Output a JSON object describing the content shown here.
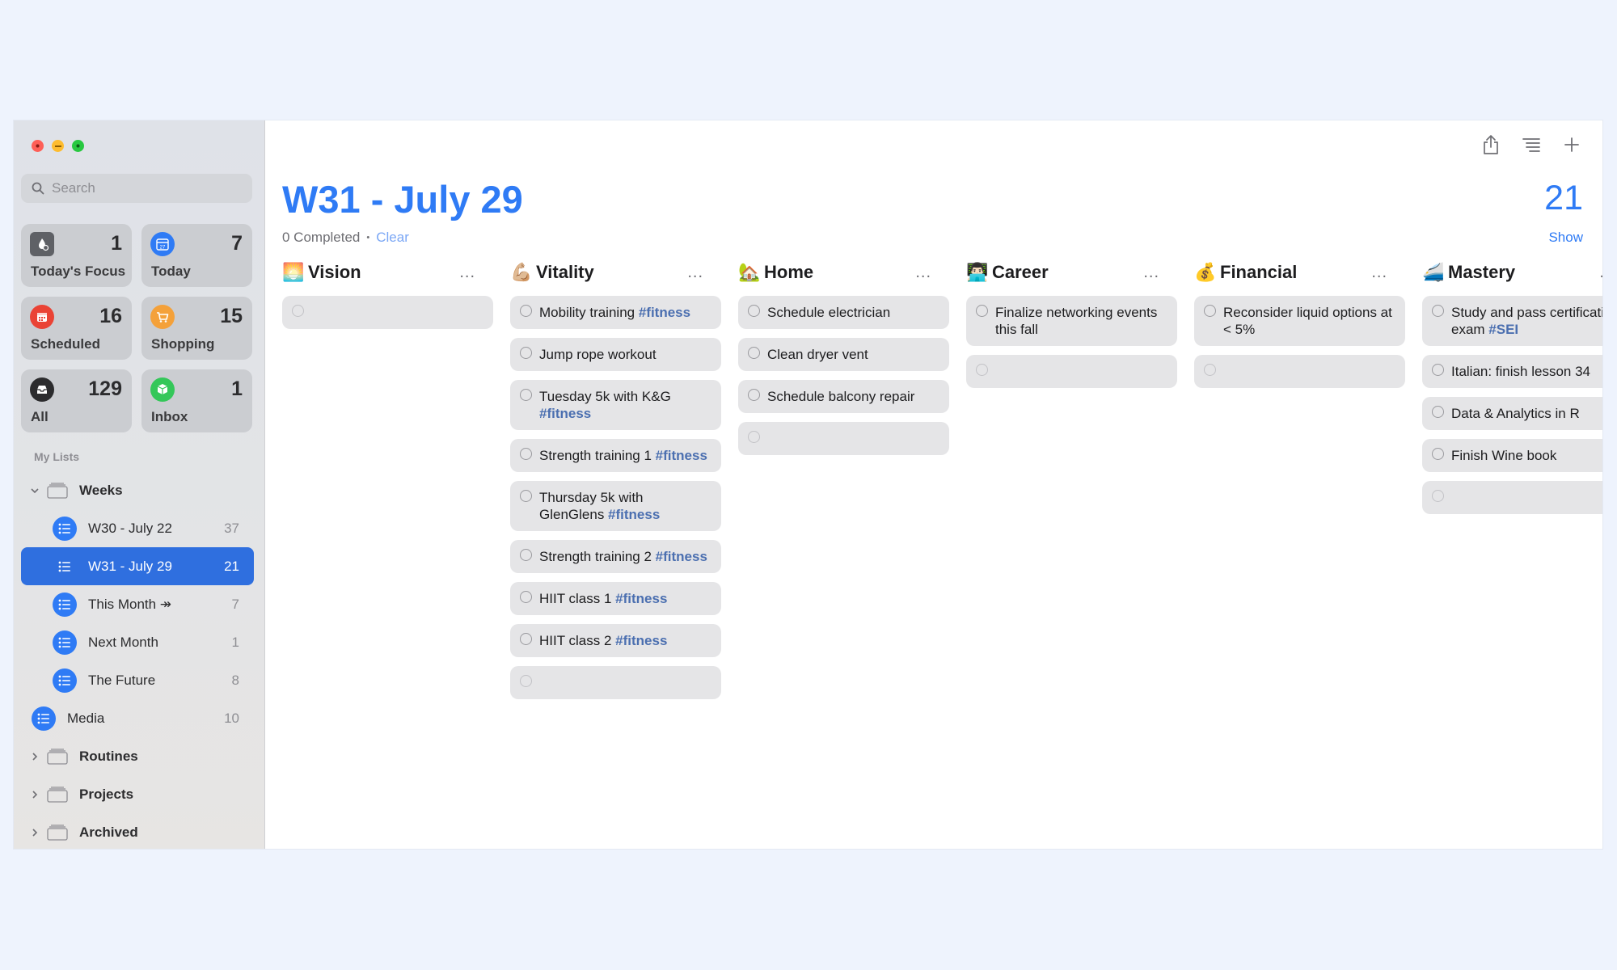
{
  "sidebar": {
    "search_placeholder": "Search",
    "tiles": [
      {
        "label": "Today's Focus",
        "count": "1",
        "icon": "focus-icon",
        "color": "#636366"
      },
      {
        "label": "Today",
        "count": "7",
        "icon": "calendar-icon",
        "color": "#2f7bf5"
      },
      {
        "label": "Scheduled",
        "count": "16",
        "icon": "calendar-grid-icon",
        "color": "#ea4335"
      },
      {
        "label": "Shopping",
        "count": "15",
        "icon": "cart-icon",
        "color": "#f4a13a"
      },
      {
        "label": "All",
        "count": "129",
        "icon": "tray-icon",
        "color": "#2c2c2e"
      },
      {
        "label": "Inbox",
        "count": "1",
        "icon": "box-icon",
        "color": "#34c759"
      }
    ],
    "my_lists_header": "My Lists",
    "groups": {
      "weeks": "Weeks",
      "routines": "Routines",
      "projects": "Projects",
      "archived": "Archived"
    },
    "lists": [
      {
        "name": "W30 - July 22",
        "count": "37"
      },
      {
        "name": "W31 - July 29",
        "count": "21"
      },
      {
        "name": "This Month ↠",
        "count": "7"
      },
      {
        "name": "Next Month",
        "count": "1"
      },
      {
        "name": "The Future",
        "count": "8"
      }
    ],
    "media": {
      "name": "Media",
      "count": "10"
    }
  },
  "main": {
    "title": "W31 - July 29",
    "count": "21",
    "show_label": "Show",
    "completed_text": "0 Completed",
    "separator": "•",
    "clear_label": "Clear",
    "more_label": "...",
    "columns": [
      {
        "emoji": "🌅",
        "name": "Vision",
        "items": []
      },
      {
        "emoji": "💪🏼",
        "name": "Vitality",
        "items": [
          {
            "text": "Mobility training ",
            "tag": "#fitness"
          },
          {
            "text": "Jump rope workout",
            "tag": ""
          },
          {
            "text": "Tuesday 5k with K&G ",
            "tag": "#fitness"
          },
          {
            "text": "Strength training 1 ",
            "tag": "#fitness"
          },
          {
            "text": "Thursday 5k with GlenGlens ",
            "tag": "#fitness"
          },
          {
            "text": "Strength training 2 ",
            "tag": "#fitness"
          },
          {
            "text": "HIIT class 1 ",
            "tag": "#fitness"
          },
          {
            "text": "HIIT class 2 ",
            "tag": "#fitness"
          }
        ]
      },
      {
        "emoji": "🏡",
        "name": "Home",
        "items": [
          {
            "text": "Schedule electrician",
            "tag": ""
          },
          {
            "text": "Clean dryer vent",
            "tag": ""
          },
          {
            "text": "Schedule balcony repair",
            "tag": ""
          }
        ]
      },
      {
        "emoji": "👨🏻‍💻",
        "name": "Career",
        "items": [
          {
            "text": "Finalize networking events this fall",
            "tag": ""
          }
        ]
      },
      {
        "emoji": "💰",
        "name": "Financial",
        "items": [
          {
            "text": "Reconsider liquid options at < 5%",
            "tag": ""
          }
        ]
      },
      {
        "emoji": "🚄",
        "name": "Mastery",
        "items": [
          {
            "text": "Study and pass certification exam ",
            "tag": "#SEI"
          },
          {
            "text": "Italian: finish lesson 34",
            "tag": ""
          },
          {
            "text": "Data & Analytics in R",
            "tag": ""
          },
          {
            "text": "Finish Wine book",
            "tag": ""
          }
        ]
      }
    ]
  }
}
